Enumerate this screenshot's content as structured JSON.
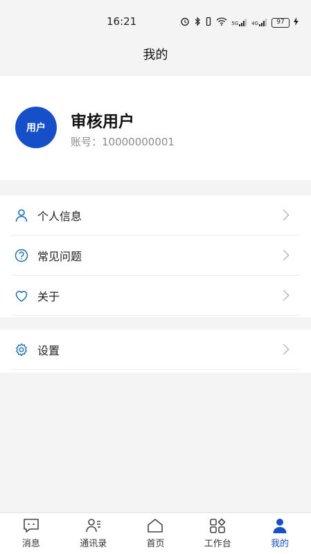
{
  "status": {
    "time": "16:21",
    "battery": "97",
    "signal_5g": "5G",
    "signal_4g": "4G"
  },
  "header": {
    "title": "我的"
  },
  "profile": {
    "avatar_text": "用户",
    "name": "审核用户",
    "account": "账号：10000000001"
  },
  "menu": {
    "personal_info": "个人信息",
    "faq": "常见问题",
    "about": "关于",
    "settings": "设置"
  },
  "tabs": {
    "messages": "消息",
    "contacts": "通讯录",
    "home": "首页",
    "workbench": "工作台",
    "mine": "我的"
  },
  "colors": {
    "accent": "#1650c9",
    "icon": "#1a6db3"
  }
}
